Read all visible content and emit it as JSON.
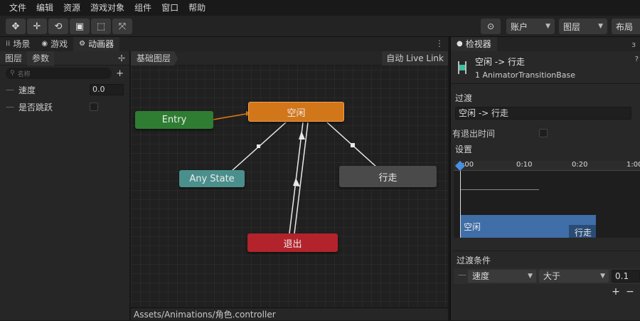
{
  "menu": [
    "文件",
    "编辑",
    "资源",
    "游戏对象",
    "组件",
    "窗口",
    "帮助"
  ],
  "toolbar": {
    "account": "账户",
    "layers": "图层",
    "layout": "布局"
  },
  "left_tabs": {
    "scene": "场景",
    "game": "游戏",
    "animator": "动画器"
  },
  "params_panel": {
    "tab_layers": "图层",
    "tab_params": "参数",
    "search_placeholder": "名称",
    "params": [
      {
        "name": "速度",
        "value": "0.0"
      },
      {
        "name": "是否跳跃",
        "value": ""
      }
    ]
  },
  "graph": {
    "breadcrumb": "基础图层",
    "live_link": "自动 Live Link",
    "nodes": {
      "entry": "Entry",
      "idle": "空闲",
      "any_state": "Any State",
      "walk": "行走",
      "exit": "退出"
    }
  },
  "status_path": "Assets/Animations/角色.controller",
  "inspector": {
    "tab": "检视器",
    "transition_title": "空闲 -> 行走",
    "transition_sub": "1 AnimatorTransitionBase",
    "section_transitions": "过渡",
    "transition_field": "空闲 -> 行走",
    "has_exit_time": "有退出时间",
    "settings": "设置",
    "timeline_ticks": [
      ":00",
      "0:10",
      "0:20",
      "1:00"
    ],
    "clip_from": "空闲",
    "clip_to": "行走",
    "conditions_title": "过渡条件",
    "condition": {
      "param": "速度",
      "op": "大于",
      "value": "0.1"
    },
    "add": "+",
    "remove": "−"
  },
  "colors": {
    "entry": "#2e7d32",
    "idle": "#d2761a",
    "any_state": "#4b8f8c",
    "walk": "#4a4a4a",
    "exit": "#b3232b",
    "clip": "#3f6ea8"
  }
}
